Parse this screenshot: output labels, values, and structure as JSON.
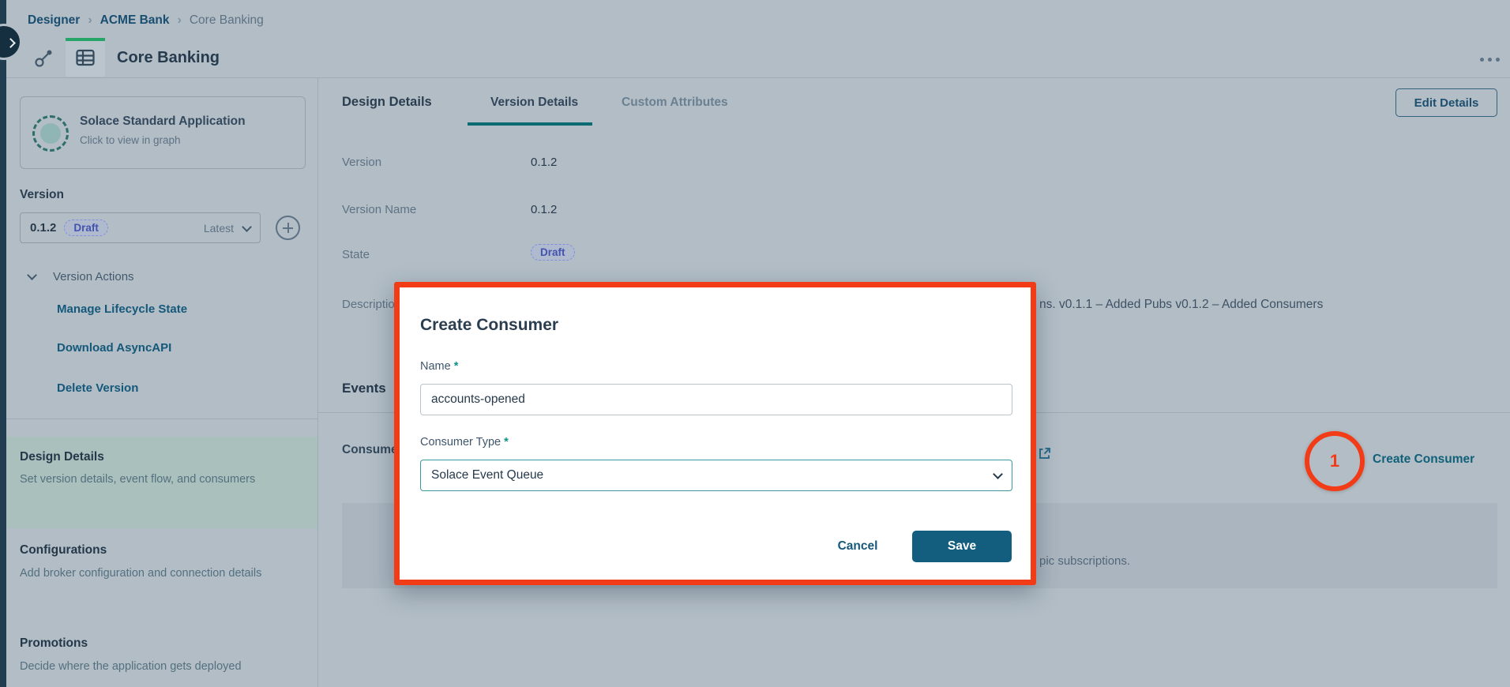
{
  "breadcrumb": {
    "items": [
      "Designer",
      "ACME Bank",
      "Core Banking"
    ],
    "separator": "›"
  },
  "header": {
    "title": "Core Banking"
  },
  "sidebar": {
    "app_card": {
      "title": "Solace Standard Application",
      "subtitle": "Click to view in graph"
    },
    "version_label": "Version",
    "version_select": {
      "version": "0.1.2",
      "state_badge": "Draft",
      "latest": "Latest"
    },
    "version_actions": {
      "label": "Version Actions",
      "links": [
        {
          "label": "Manage Lifecycle State"
        },
        {
          "label": "Download AsyncAPI"
        },
        {
          "label": "Delete Version"
        }
      ]
    },
    "nav": [
      {
        "title": "Design Details",
        "subtitle": "Set version details, event flow, and consumers",
        "selected": true
      },
      {
        "title": "Configurations",
        "subtitle": "Add broker configuration and connection details",
        "selected": false
      },
      {
        "title": "Promotions",
        "subtitle": "Decide where the application gets deployed",
        "selected": false
      }
    ]
  },
  "main": {
    "tabs": [
      {
        "label": "Design Details",
        "active": false
      },
      {
        "label": "Version Details",
        "active": true
      },
      {
        "label": "Custom Attributes",
        "active": false
      }
    ],
    "edit_details_button": "Edit Details",
    "fields": [
      {
        "label": "Version",
        "value": "0.1.2"
      },
      {
        "label": "Version Name",
        "value": "0.1.2"
      },
      {
        "label": "State",
        "value": "Draft"
      },
      {
        "label": "Description",
        "value_visible": "ns. v0.1.1 – Added Pubs v0.1.2 – Added Consumers"
      }
    ],
    "events_heading": "Events",
    "consumers_label": "Consumers",
    "create_consumer_link": "Create Consumer",
    "empty_state_fragment": "pic subscriptions.",
    "annotation_number": "1"
  },
  "modal": {
    "title": "Create Consumer",
    "name_label": "Name",
    "required_mark": "*",
    "name_value": "accounts-opened",
    "type_label": "Consumer Type",
    "type_value": "Solace Event Queue",
    "cancel_button": "Cancel",
    "save_button": "Save"
  },
  "colors": {
    "page_bg": "#b2bdc6",
    "annotation_orange": "#f23c17",
    "save_button_bg": "#135e7e",
    "tab_underline": "#0c6b72",
    "active_icon_tab_bar": "#27a468",
    "link_teal": "#14587a",
    "draft_badge_text": "#4353ae",
    "selected_nav_bg": "#a9c0bd"
  }
}
